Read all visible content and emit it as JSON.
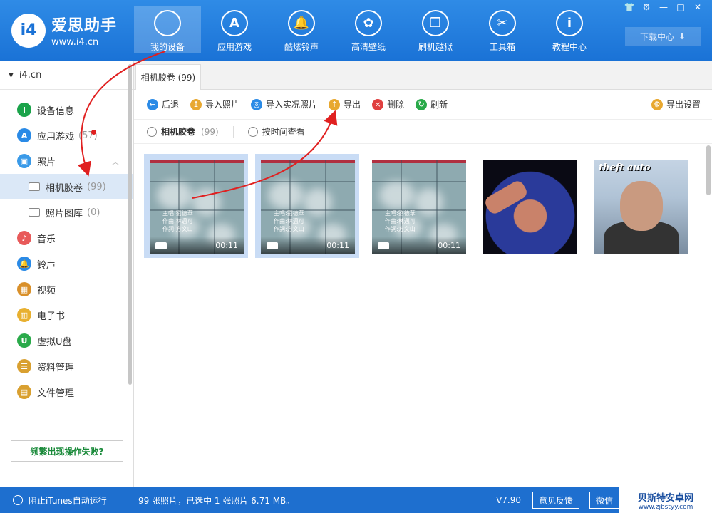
{
  "app": {
    "name": "爱思助手",
    "url": "www.i4.cn",
    "logo_text": "i4"
  },
  "nav": [
    {
      "label": "我的设备",
      "icon": "apple-icon",
      "glyph": "",
      "active": true
    },
    {
      "label": "应用游戏",
      "icon": "appstore-icon",
      "glyph": "A"
    },
    {
      "label": "酷炫铃声",
      "icon": "bell-icon",
      "glyph": "🔔"
    },
    {
      "label": "高清壁纸",
      "icon": "flower-icon",
      "glyph": "✿"
    },
    {
      "label": "刷机越狱",
      "icon": "box-icon",
      "glyph": "❒"
    },
    {
      "label": "工具箱",
      "icon": "tools-icon",
      "glyph": "✂"
    },
    {
      "label": "教程中心",
      "icon": "info-icon",
      "glyph": "i"
    }
  ],
  "window_controls": [
    "👕",
    "⚙",
    "—",
    "□",
    "✕"
  ],
  "download": {
    "label": "下载中心",
    "icon": "download-icon"
  },
  "sidebar": {
    "device": "i4.cn",
    "items": [
      {
        "label": "设备信息",
        "icon": "info-circle-icon",
        "color": "#1aa34a",
        "glyph": "i"
      },
      {
        "label": "应用游戏",
        "icon": "appstore-icon",
        "color": "#2a8ae6",
        "glyph": "A",
        "count": "(57)"
      },
      {
        "label": "照片",
        "icon": "photo-icon",
        "color": "#3a9ae8",
        "glyph": "▣"
      },
      {
        "label": "相机胶卷",
        "icon": "folder-icon",
        "count": "(99)",
        "sub": true,
        "selected": true
      },
      {
        "label": "照片图库",
        "icon": "folder-icon",
        "count": "(0)",
        "sub": true
      },
      {
        "label": "音乐",
        "icon": "music-icon",
        "color": "#e85a5a",
        "glyph": "♪"
      },
      {
        "label": "铃声",
        "icon": "bell-icon",
        "color": "#2a8ae6",
        "glyph": "🔔"
      },
      {
        "label": "视频",
        "icon": "film-icon",
        "color": "#d9902a",
        "glyph": "▦"
      },
      {
        "label": "电子书",
        "icon": "book-icon",
        "color": "#e8b030",
        "glyph": "▥"
      },
      {
        "label": "虚拟U盘",
        "icon": "usb-icon",
        "color": "#2aaa4a",
        "glyph": "U"
      },
      {
        "label": "资料管理",
        "icon": "contacts-icon",
        "color": "#d9a030",
        "glyph": "☰"
      },
      {
        "label": "文件管理",
        "icon": "file-icon",
        "color": "#d9a030",
        "glyph": "▤"
      }
    ],
    "fail_button": "频繁出现操作失败?"
  },
  "main": {
    "tab": "相机胶卷 (99)",
    "toolbar": [
      {
        "label": "后退",
        "icon": "back-icon",
        "color": "#2a8ae6",
        "glyph": "←"
      },
      {
        "label": "导入照片",
        "icon": "import-icon",
        "color": "#e8a830",
        "glyph": "↥"
      },
      {
        "label": "导入实况照片",
        "icon": "live-photo-icon",
        "color": "#2a8ae6",
        "glyph": "◎"
      },
      {
        "label": "导出",
        "icon": "export-icon",
        "color": "#e8a830",
        "glyph": "↑"
      },
      {
        "label": "删除",
        "icon": "delete-icon",
        "color": "#e04040",
        "glyph": "×"
      },
      {
        "label": "刷新",
        "icon": "refresh-icon",
        "color": "#2aaa4a",
        "glyph": "↻"
      }
    ],
    "export_settings": "导出设置",
    "filters": [
      {
        "label": "相机胶卷",
        "count": "(99)"
      },
      {
        "label": "按时间查看"
      }
    ],
    "thumbs": [
      {
        "type": "video",
        "duration": "00:11",
        "selected": true
      },
      {
        "type": "video",
        "duration": "00:11",
        "selected": true
      },
      {
        "type": "video",
        "duration": "00:11",
        "selected": false
      },
      {
        "type": "photo",
        "variant": "photo1",
        "selected": false
      },
      {
        "type": "photo",
        "variant": "photo2",
        "selected": false,
        "overlay": "theft auto"
      }
    ],
    "lyrics": "主唱:劉德華\n作曲:林邁可\n作詞:方文山"
  },
  "status": {
    "itunes": "阻止iTunes自动运行",
    "text": "99 张照片，已选中 1 张照片 6.71 MB。",
    "version": "V7.90",
    "feedback": "意见反馈",
    "wechat": "微信"
  },
  "watermark": {
    "title": "贝斯特安卓网",
    "url": "www.zjbstyy.com"
  },
  "colors": {
    "header": "#1a72d6",
    "status": "#1e6fcf",
    "arrow": "#e02020",
    "selected": "#dbe8f7"
  }
}
